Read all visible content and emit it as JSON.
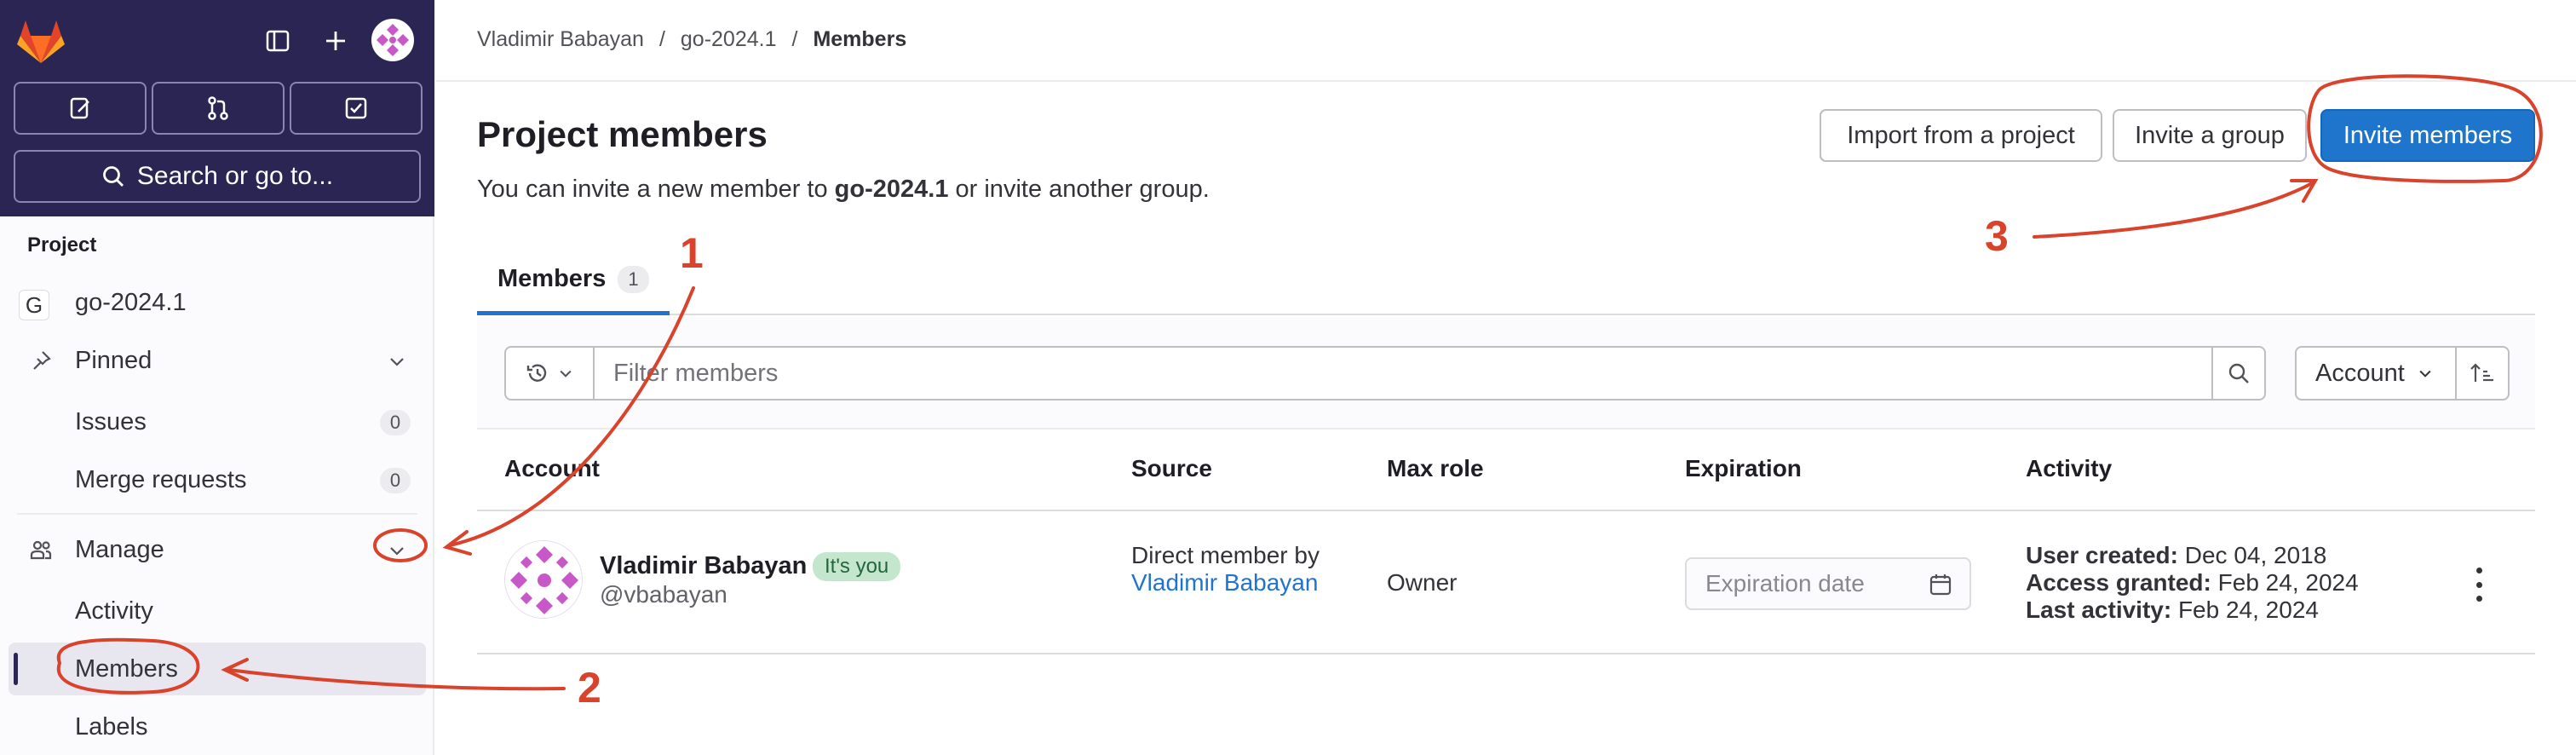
{
  "sidebar": {
    "search_label": "Search or go to...",
    "section_title": "Project",
    "project_name": "go-2024.1",
    "project_initial": "G",
    "items": [
      {
        "label": "Pinned"
      },
      {
        "label": "Issues",
        "count": "0"
      },
      {
        "label": "Merge requests",
        "count": "0"
      },
      {
        "label": "Manage"
      },
      {
        "label": "Activity"
      },
      {
        "label": "Members"
      },
      {
        "label": "Labels"
      }
    ]
  },
  "breadcrumb": {
    "items": [
      "Vladimir Babayan",
      "go-2024.1",
      "Members"
    ],
    "separator": "/"
  },
  "header": {
    "title": "Project members",
    "desc_prefix": "You can invite a new member to ",
    "desc_project": "go-2024.1",
    "desc_suffix": " or invite another group.",
    "import_label": "Import from a project",
    "invite_group_label": "Invite a group",
    "invite_members_label": "Invite members"
  },
  "tabs": [
    {
      "label": "Members",
      "count": "1"
    }
  ],
  "filter": {
    "placeholder": "Filter members",
    "sort_label": "Account"
  },
  "table": {
    "headers": [
      "Account",
      "Source",
      "Max role",
      "Expiration",
      "Activity"
    ],
    "rows": [
      {
        "name": "Vladimir Babayan",
        "badge": "It's you",
        "username": "@vbabayan",
        "source_prefix": "Direct member by ",
        "source_link": "Vladimir Babayan",
        "role": "Owner",
        "expiration_placeholder": "Expiration date",
        "user_created_label": "User created:",
        "user_created": "Dec 04, 2018",
        "access_granted_label": "Access granted:",
        "access_granted": "Feb 24, 2024",
        "last_activity_label": "Last activity:",
        "last_activity": "Feb 24, 2024"
      }
    ]
  },
  "annotations": [
    "1",
    "2",
    "3"
  ],
  "colors": {
    "sidebar_dark": "#2b2553",
    "primary": "#1f75cb",
    "annotation": "#d9422b"
  }
}
